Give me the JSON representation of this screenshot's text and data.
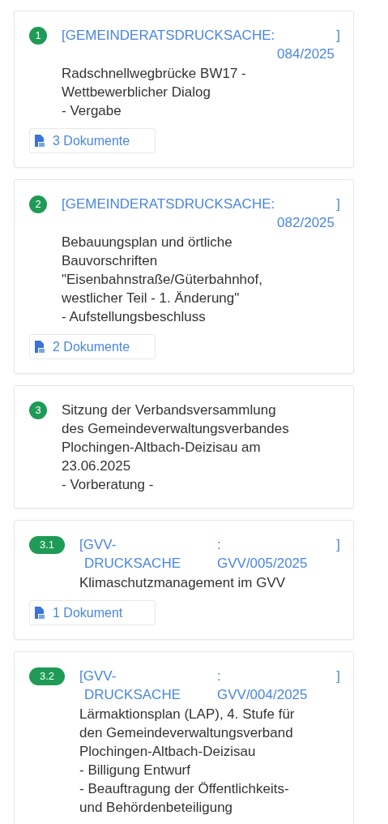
{
  "items": [
    {
      "badge": "1",
      "reference": {
        "kind": "council",
        "label": "[GEMEINDERATSDRUCKSACHE:",
        "number": "084/2025",
        "close": "]"
      },
      "title": "Radschnellwegbrücke BW17 -\nWettbewerblicher Dialog\n- Vergabe",
      "documents": "3 Dokumente"
    },
    {
      "badge": "2",
      "reference": {
        "kind": "council",
        "label": "[GEMEINDERATSDRUCKSACHE:",
        "number": "082/2025",
        "close": "]"
      },
      "title": "Bebauungsplan und örtliche\nBauvorschriften\n\"Eisenbahnstraße/Güterbahnhof,\nwestlicher Teil - 1. Änderung\"\n- Aufstellungsbeschluss",
      "documents": "2 Dokumente"
    },
    {
      "badge": "3",
      "title": "Sitzung der Verbandsversammlung\ndes Gemeindeverwaltungsverbandes\nPlochingen-Altbach-Deizisau am\n23.06.2025\n- Vorberatung -"
    },
    {
      "badge": "3.1",
      "reference": {
        "kind": "gvv",
        "label": "[GVV-",
        "label_cont": "DRUCKSACHE",
        "colon": ":",
        "number": "GVV/005/2025",
        "close": "]"
      },
      "title": "Klimaschutzmanagement im GVV",
      "documents": "1 Dokument"
    },
    {
      "badge": "3.2",
      "reference": {
        "kind": "gvv",
        "label": "[GVV-",
        "label_cont": "DRUCKSACHE",
        "colon": ":",
        "number": "GVV/004/2025",
        "close": "]"
      },
      "title": "Lärmaktionsplan (LAP), 4. Stufe für\nden Gemeindeverwaltungsverband\nPlochingen-Altbach-Deizisau\n- Billigung Entwurf\n- Beauftragung der Öffentlichkeits-\nund Behördenbeteiligung"
    }
  ]
}
